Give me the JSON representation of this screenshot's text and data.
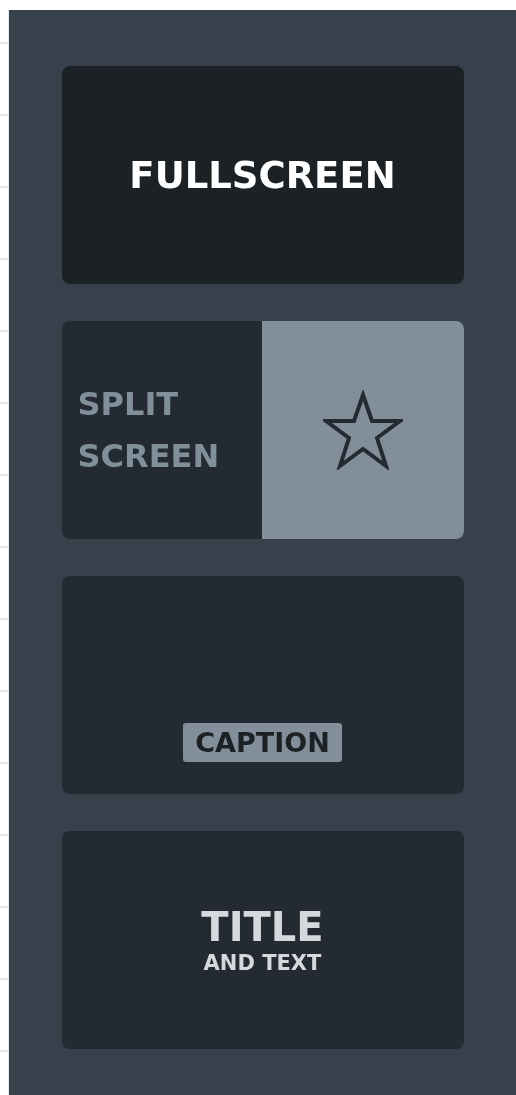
{
  "layouts": [
    {
      "kind": "fullscreen",
      "label": "FULLSCREEN",
      "selected": true
    },
    {
      "kind": "split",
      "label": "SPLIT SCREEN",
      "selected": false
    },
    {
      "kind": "caption",
      "label": "CAPTION",
      "selected": false
    },
    {
      "kind": "title",
      "title": "TITLE",
      "subtitle": "AND TEXT",
      "selected": false
    }
  ]
}
